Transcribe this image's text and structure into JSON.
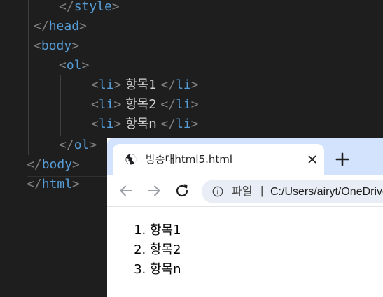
{
  "editor": {
    "lines": [
      {
        "name": "code-line-style-close",
        "segments": [
          [
            "punct",
            "</"
          ],
          [
            "tag",
            "style"
          ],
          [
            "punct",
            ">"
          ]
        ]
      },
      {
        "name": "code-line-head-close",
        "segments": [
          [
            "punct",
            "</"
          ],
          [
            "tag",
            "head"
          ],
          [
            "punct",
            ">"
          ]
        ]
      },
      {
        "name": "code-line-body-open",
        "segments": [
          [
            "punct",
            "<"
          ],
          [
            "tag",
            "body"
          ],
          [
            "punct",
            ">"
          ]
        ]
      },
      {
        "name": "code-line-ol-open",
        "segments": [
          [
            "punct",
            "<"
          ],
          [
            "tag",
            "ol"
          ],
          [
            "punct",
            ">"
          ]
        ]
      },
      {
        "name": "code-line-li-1",
        "segments": [
          [
            "punct",
            "<"
          ],
          [
            "tag",
            "li"
          ],
          [
            "punct",
            ">"
          ],
          [
            "txt",
            " 항목1 "
          ],
          [
            "punct",
            "</"
          ],
          [
            "tag",
            "li"
          ],
          [
            "punct",
            ">"
          ]
        ]
      },
      {
        "name": "code-line-li-2",
        "segments": [
          [
            "punct",
            "<"
          ],
          [
            "tag",
            "li"
          ],
          [
            "punct",
            ">"
          ],
          [
            "txt",
            " 항목2 "
          ],
          [
            "punct",
            "</"
          ],
          [
            "tag",
            "li"
          ],
          [
            "punct",
            ">"
          ]
        ]
      },
      {
        "name": "code-line-li-n",
        "segments": [
          [
            "punct",
            "<"
          ],
          [
            "tag",
            "li"
          ],
          [
            "punct",
            ">"
          ],
          [
            "txt",
            " 항목n "
          ],
          [
            "punct",
            "</"
          ],
          [
            "tag",
            "li"
          ],
          [
            "punct",
            ">"
          ]
        ]
      },
      {
        "name": "code-line-ol-close",
        "segments": [
          [
            "punct",
            "</"
          ],
          [
            "tag",
            "ol"
          ],
          [
            "punct",
            ">"
          ]
        ]
      },
      {
        "name": "code-line-body-close",
        "segments": [
          [
            "punct",
            "</"
          ],
          [
            "tag",
            "body"
          ],
          [
            "punct",
            ">"
          ]
        ]
      },
      {
        "name": "code-line-html-close",
        "segments": [
          [
            "punct",
            "</"
          ],
          [
            "tag",
            "html"
          ],
          [
            "punct",
            ">"
          ]
        ]
      }
    ],
    "colors": {
      "tag": "#569cd6",
      "punct": "#808080",
      "text": "#d4d4d4",
      "background": "#1e1e1e"
    }
  },
  "browser": {
    "tab": {
      "title": "방송대html5.html",
      "icon": "globe-icon",
      "close_icon": "close-icon"
    },
    "new_tab_icon": "plus-icon",
    "toolbar": {
      "back_icon": "arrow-left-icon",
      "forward_icon": "arrow-right-icon",
      "reload_icon": "reload-icon",
      "info_icon": "info-icon",
      "site_label": "파일",
      "separator": "|",
      "url": "C:/Users/airyt/OneDrive"
    },
    "page": {
      "list_items": [
        "항목1",
        "항목2",
        "항목n"
      ]
    },
    "colors": {
      "tabstrip": "#d3e3fd",
      "omnibox": "#e9eef6"
    }
  }
}
